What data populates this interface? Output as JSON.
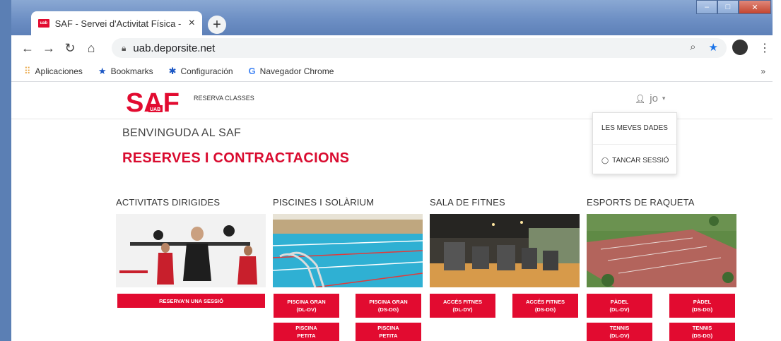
{
  "browser": {
    "tab_title": "SAF - Servei d'Activitat Física - Ur",
    "favicon_text": "uab",
    "url": "uab.deporsite.net",
    "bookmarks": [
      {
        "label": "Aplicaciones"
      },
      {
        "label": "Bookmarks"
      },
      {
        "label": "Configuración"
      },
      {
        "label": "Navegador Chrome"
      }
    ],
    "bookmarks_overflow": "»"
  },
  "site": {
    "logo_text": "SAF",
    "logo_sub": "UAB",
    "reserva_link": "RESERVA CLASSES",
    "user_label": "jo",
    "user_menu": [
      {
        "label": "LES MEVES DADES"
      },
      {
        "label": "TANCAR SESSIÓ"
      }
    ],
    "welcome": "BENVINGUDA AL SAF",
    "headline": "RESERVES I CONTRACTACIONS"
  },
  "sections": [
    {
      "title": "ACTIVITATS DIRIGIDES",
      "buttons": [
        "RESERVA'N UNA SESSIÓ"
      ]
    },
    {
      "title": "PISCINES I SOLÀRIUM",
      "buttons": [
        "PISCINA GRAN\n(DL-DV)",
        "PISCINA GRAN\n(DS-DG)",
        "PISCINA\nPETITA",
        "PISCINA\nPETITA"
      ]
    },
    {
      "title": "SALA DE FITNES",
      "buttons": [
        "ACCÉS FITNES\n(DL-DV)",
        "ACCÉS FITNES\n(DS-DG)"
      ]
    },
    {
      "title": "ESPORTS DE RAQUETA",
      "buttons": [
        "PÀDEL\n(DL-DV)",
        "PÀDEL\n(DS-DG)",
        "TENNIS\n(DL-DV)",
        "TENNIS\n(DS-DG)"
      ]
    }
  ],
  "colors": {
    "brand_red": "#e20b30",
    "headline_red": "#d90b2f"
  }
}
